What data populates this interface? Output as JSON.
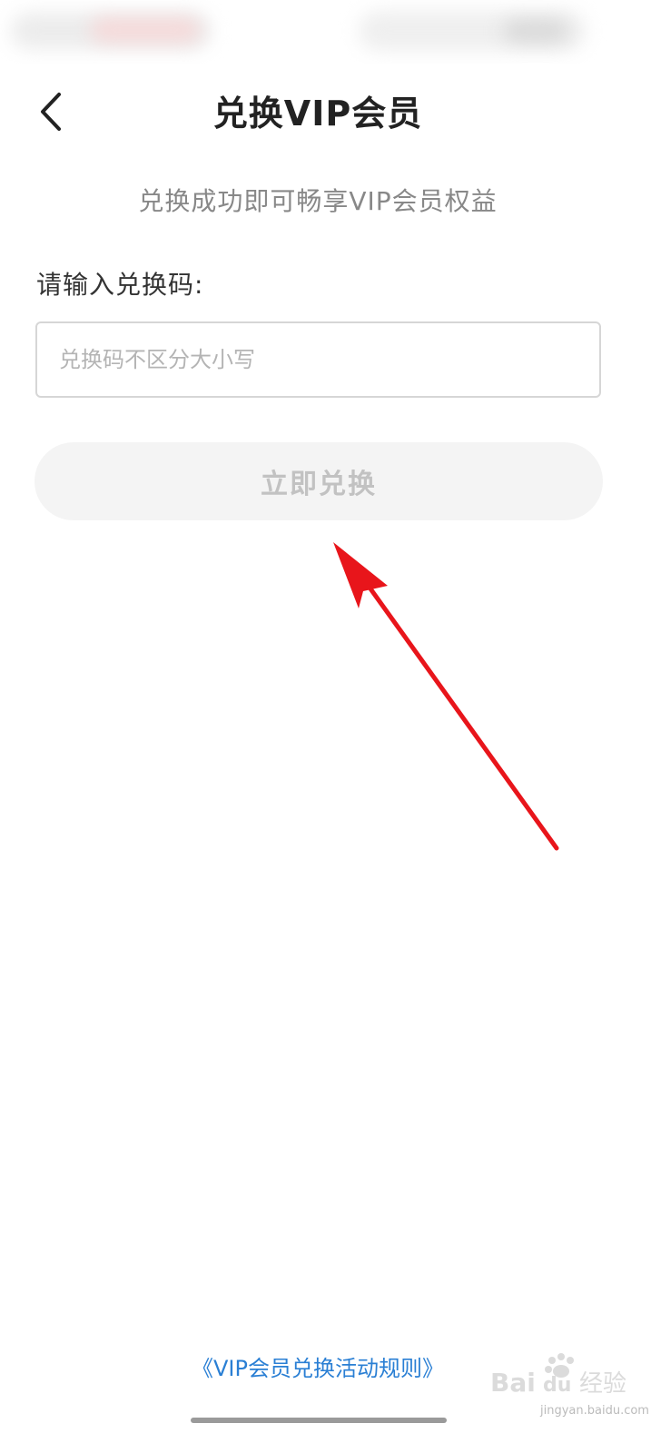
{
  "header": {
    "title": "兑换VIP会员",
    "back_icon": "chevron-left-icon"
  },
  "subtitle": "兑换成功即可畅享VIP会员权益",
  "form": {
    "label": "请输入兑换码:",
    "input_placeholder": "兑换码不区分大小写",
    "input_value": "",
    "submit_label": "立即兑换"
  },
  "footer": {
    "rules_link": "《VIP会员兑换活动规则》"
  },
  "watermark": {
    "text": "Bai du 经验",
    "sub": "jingyan.baidu.com"
  },
  "colors": {
    "link": "#2a7fd4",
    "annotation_arrow": "#e8151b",
    "button_disabled_bg": "#f4f4f4",
    "button_disabled_text": "#c2c2c2"
  }
}
